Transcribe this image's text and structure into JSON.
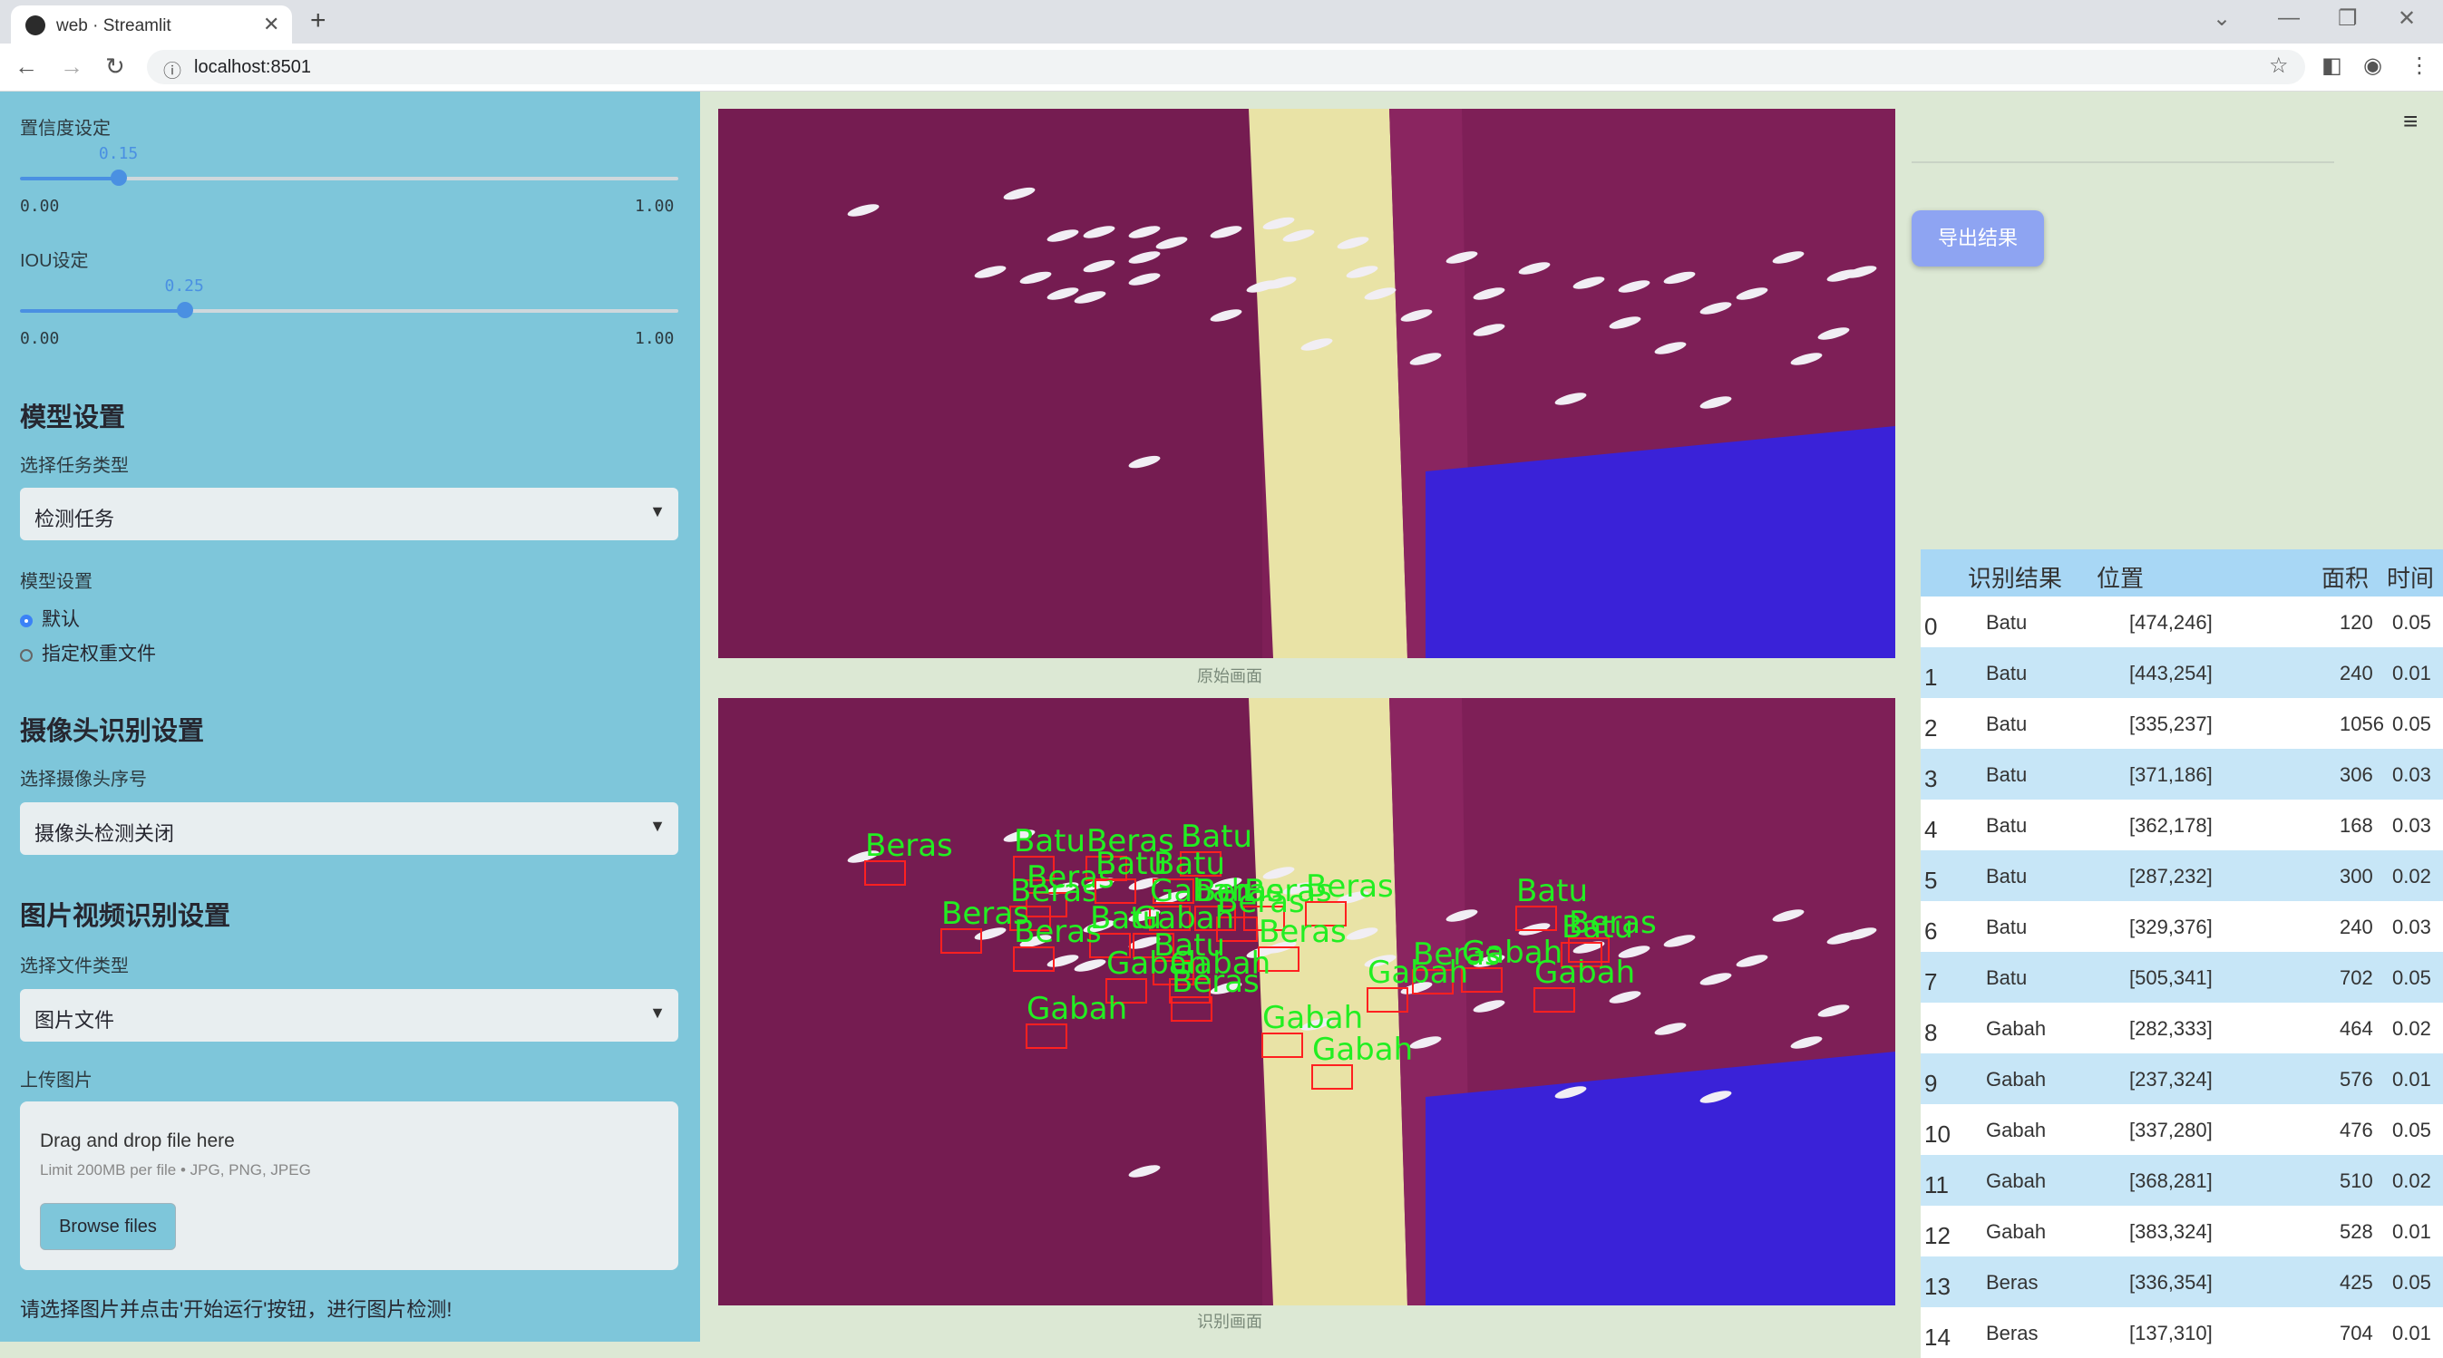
{
  "browser": {
    "tab_title": "web · Streamlit",
    "url": "localhost:8501"
  },
  "sidebar": {
    "confidence": {
      "label": "置信度设定",
      "value": "0.15",
      "min": "0.00",
      "max": "1.00",
      "fraction": 0.15
    },
    "iou": {
      "label": "IOU设定",
      "value": "0.25",
      "min": "0.00",
      "max": "1.00",
      "fraction": 0.25
    },
    "model_header": "模型设置",
    "task_label": "选择任务类型",
    "task_value": "检测任务",
    "model_label": "模型设置",
    "radio_default": "默认",
    "radio_custom": "指定权重文件",
    "camera_header": "摄像头识别设置",
    "camera_label": "选择摄像头序号",
    "camera_value": "摄像头检测关闭",
    "media_header": "图片视频识别设置",
    "filetype_label": "选择文件类型",
    "filetype_value": "图片文件",
    "upload_label": "上传图片",
    "upload_title": "Drag and drop file here",
    "upload_limit": "Limit 200MB per file • JPG, PNG, JPEG",
    "browse_label": "Browse files",
    "hint": "请选择图片并点击'开始运行'按钮，进行图片检测!"
  },
  "main": {
    "caption_original": "原始画面",
    "caption_detected": "识别画面",
    "export_label": "导出结果"
  },
  "detection_labels": [
    "Beras",
    "Batu",
    "Beras",
    "Batu",
    "Beras",
    "Beras",
    "Batu",
    "Batu",
    "Beras",
    "Beras",
    "Batu",
    "Gabah",
    "Beras",
    "Beras",
    "Batu",
    "Beras",
    "Gabah",
    "Beras",
    "Beras",
    "Batu",
    "Beras",
    "Gabah",
    "Gabah",
    "Beras",
    "Batu",
    "Gabah",
    "Gabah",
    "Gabah",
    "Beras",
    "Gabah",
    "Gabah",
    "Gabah"
  ],
  "table": {
    "headers": [
      "识别结果",
      "位置",
      "面积",
      "时间"
    ],
    "rows": [
      {
        "idx": "0",
        "cls": "Batu",
        "pos": "[474,246]",
        "area": "120",
        "time": "0.05"
      },
      {
        "idx": "1",
        "cls": "Batu",
        "pos": "[443,254]",
        "area": "240",
        "time": "0.01"
      },
      {
        "idx": "2",
        "cls": "Batu",
        "pos": "[335,237]",
        "area": "1056",
        "time": "0.05"
      },
      {
        "idx": "3",
        "cls": "Batu",
        "pos": "[371,186]",
        "area": "306",
        "time": "0.03"
      },
      {
        "idx": "4",
        "cls": "Batu",
        "pos": "[362,178]",
        "area": "168",
        "time": "0.03"
      },
      {
        "idx": "5",
        "cls": "Batu",
        "pos": "[287,232]",
        "area": "300",
        "time": "0.02"
      },
      {
        "idx": "6",
        "cls": "Batu",
        "pos": "[329,376]",
        "area": "240",
        "time": "0.03"
      },
      {
        "idx": "7",
        "cls": "Batu",
        "pos": "[505,341]",
        "area": "702",
        "time": "0.05"
      },
      {
        "idx": "8",
        "cls": "Gabah",
        "pos": "[282,333]",
        "area": "464",
        "time": "0.02"
      },
      {
        "idx": "9",
        "cls": "Gabah",
        "pos": "[237,324]",
        "area": "576",
        "time": "0.01"
      },
      {
        "idx": "10",
        "cls": "Gabah",
        "pos": "[337,280]",
        "area": "476",
        "time": "0.05"
      },
      {
        "idx": "11",
        "cls": "Gabah",
        "pos": "[368,281]",
        "area": "510",
        "time": "0.02"
      },
      {
        "idx": "12",
        "cls": "Gabah",
        "pos": "[383,324]",
        "area": "528",
        "time": "0.01"
      },
      {
        "idx": "13",
        "cls": "Beras",
        "pos": "[336,354]",
        "area": "425",
        "time": "0.05"
      },
      {
        "idx": "14",
        "cls": "Beras",
        "pos": "[137,310]",
        "area": "704",
        "time": "0.01"
      }
    ]
  },
  "colors": {
    "sidebar": "#7ec6da",
    "accent": "#4a90e2",
    "export_button": "#8ea4f2",
    "detection_box": "#ff2020",
    "detection_label": "#22ee22"
  }
}
